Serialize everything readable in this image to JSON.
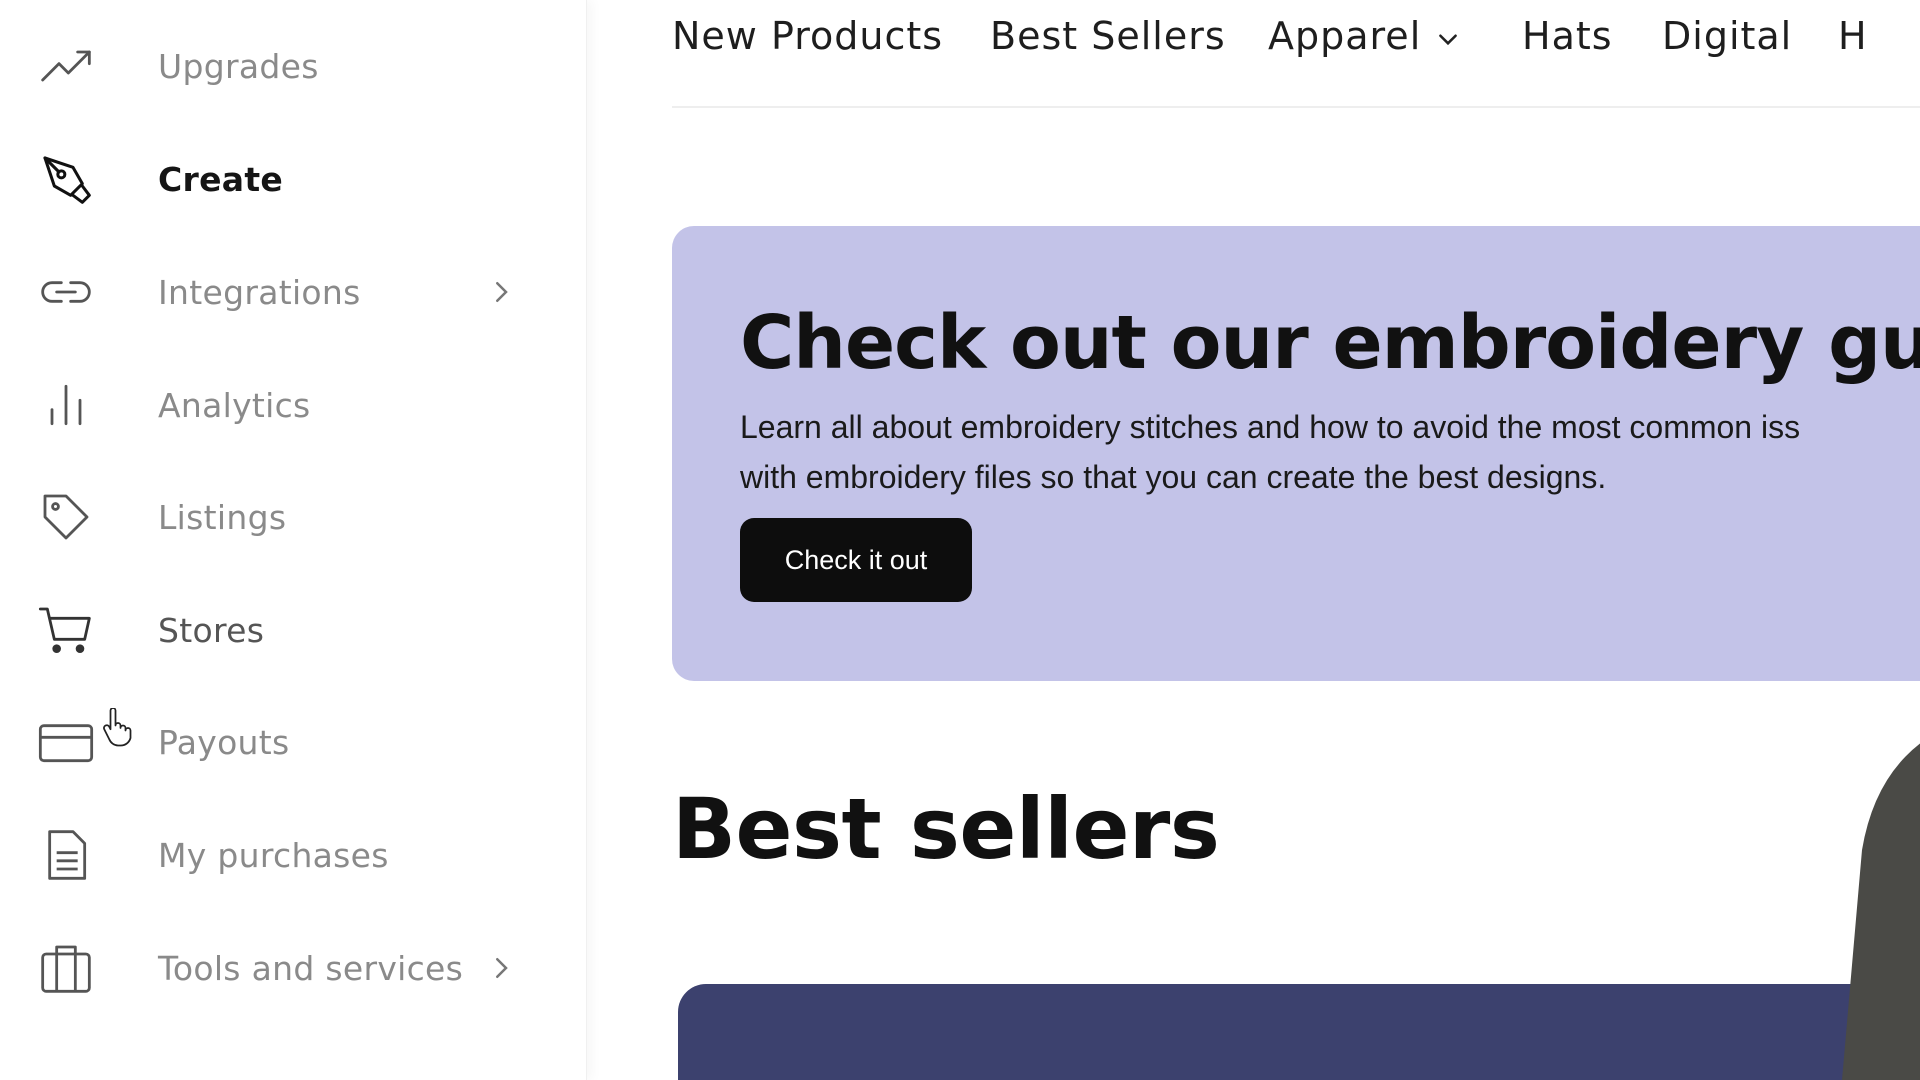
{
  "sidebar": {
    "items": [
      {
        "label": "Upgrades",
        "icon": "trending-up-icon"
      },
      {
        "label": "Create",
        "icon": "pen-tool-icon",
        "active": true
      },
      {
        "label": "Integrations",
        "icon": "link-icon",
        "has_chevron": true
      },
      {
        "label": "Analytics",
        "icon": "bar-chart-icon"
      },
      {
        "label": "Listings",
        "icon": "tag-icon"
      },
      {
        "label": "Stores",
        "icon": "cart-icon"
      },
      {
        "label": "Payouts",
        "icon": "credit-card-icon"
      },
      {
        "label": "My purchases",
        "icon": "document-icon"
      },
      {
        "label": "Tools and services",
        "icon": "briefcase-icon",
        "has_chevron": true
      }
    ]
  },
  "topnav": {
    "items": [
      "New Products",
      "Best Sellers",
      "Apparel",
      "Hats",
      "Digital",
      "H"
    ]
  },
  "banner": {
    "title": "Check out our embroidery guide!",
    "text_line1": "Learn all about embroidery stitches and how to avoid the most common iss",
    "text_line2": "with embroidery files so that you can create the best designs.",
    "button_label": "Check it out",
    "background_color": "#c3c3e8"
  },
  "section": {
    "title": "Best sellers"
  },
  "colors": {
    "active_text": "#151515",
    "inactive_text": "#8a8a8a",
    "button_bg": "#0d0d0d",
    "card_bg": "#3c416e"
  }
}
